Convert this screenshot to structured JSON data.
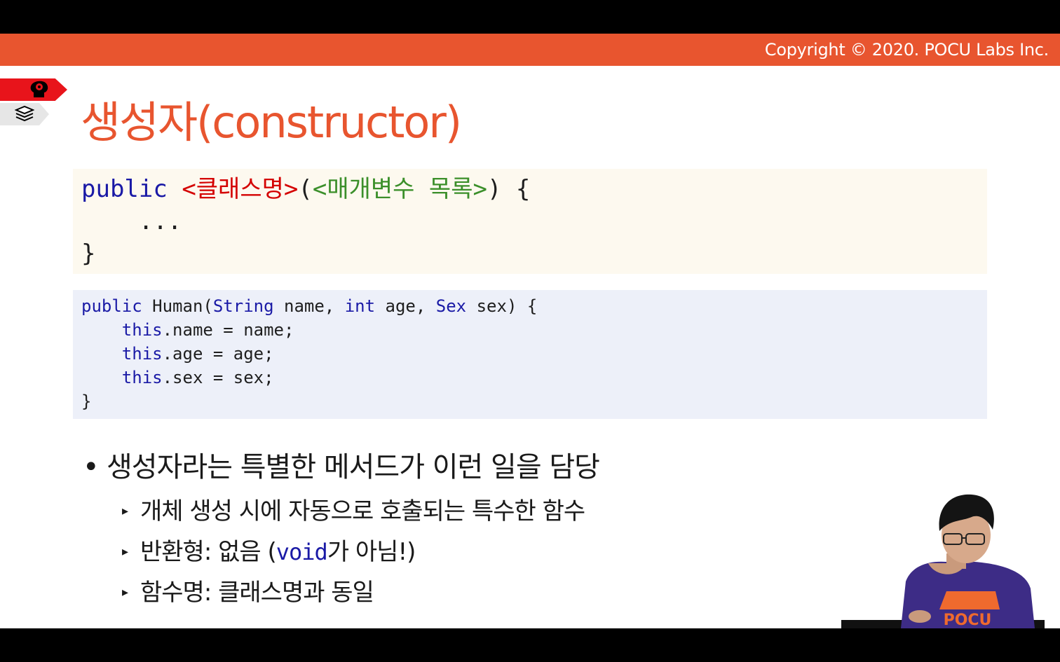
{
  "header": {
    "copyright": "Copyright © 2020. POCU Labs Inc."
  },
  "side_tags": {
    "top_icon": "brain-icon",
    "bottom_icon": "book-stack-icon",
    "top_color": "#e8141b",
    "bottom_color": "#e6e6e6"
  },
  "title": "생성자(constructor)",
  "code_syntax": {
    "line1": {
      "kw": "public",
      "class_name": "<클래스명>",
      "open_paren": "(",
      "params": "<매개변수 목록>",
      "close": ") {"
    },
    "line2": "    ...",
    "line3": "}"
  },
  "code_example": {
    "l1": {
      "kw": "public",
      "name": " Human(",
      "t1": "String",
      "p1": " name, ",
      "t2": "int",
      "p2": " age, ",
      "t3": "Sex",
      "p3": " sex) {"
    },
    "l2": {
      "kw": "this",
      "rest": ".name = name;"
    },
    "l3": {
      "kw": "this",
      "rest": ".age = age;"
    },
    "l4": {
      "kw": "this",
      "rest": ".sex = sex;"
    },
    "l5": "}"
  },
  "bullets": {
    "main": "생성자라는 특별한 메서드가 이런 일을 담당",
    "sub1": "개체 생성 시에 자동으로 호출되는 특수한 함수",
    "sub2_pre": "반환형: 없음 (",
    "sub2_code": "void",
    "sub2_post": "가 아님!)",
    "sub3": "함수명: 클래스명과 동일"
  },
  "colors": {
    "accent": "#e8552f",
    "keyword": "#1a1aa6",
    "syntax_red": "#d40000",
    "syntax_green": "#3b8f2a"
  },
  "presenter": {
    "shirt_logo": "POCU"
  }
}
